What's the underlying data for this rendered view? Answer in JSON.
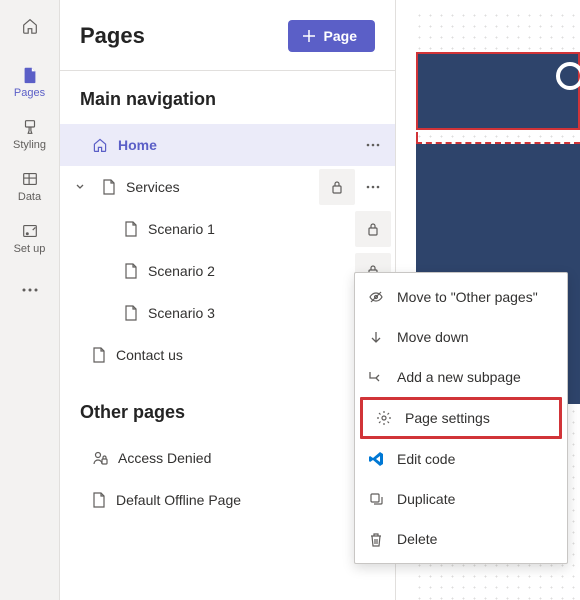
{
  "rail": {
    "items": [
      {
        "label": "Pages"
      },
      {
        "label": "Styling"
      },
      {
        "label": "Data"
      },
      {
        "label": "Set up"
      }
    ]
  },
  "panel": {
    "title": "Pages",
    "add_button": "Page"
  },
  "sections": {
    "main_nav": "Main navigation",
    "other": "Other pages"
  },
  "tree": {
    "home": "Home",
    "services": "Services",
    "scenario1": "Scenario 1",
    "scenario2": "Scenario 2",
    "scenario3": "Scenario 3",
    "contact": "Contact us",
    "access_denied": "Access Denied",
    "offline": "Default Offline Page"
  },
  "menu": {
    "move_to_other": "Move to \"Other pages\"",
    "move_down": "Move down",
    "add_subpage": "Add a new subpage",
    "page_settings": "Page settings",
    "edit_code": "Edit code",
    "duplicate": "Duplicate",
    "delete": "Delete"
  }
}
